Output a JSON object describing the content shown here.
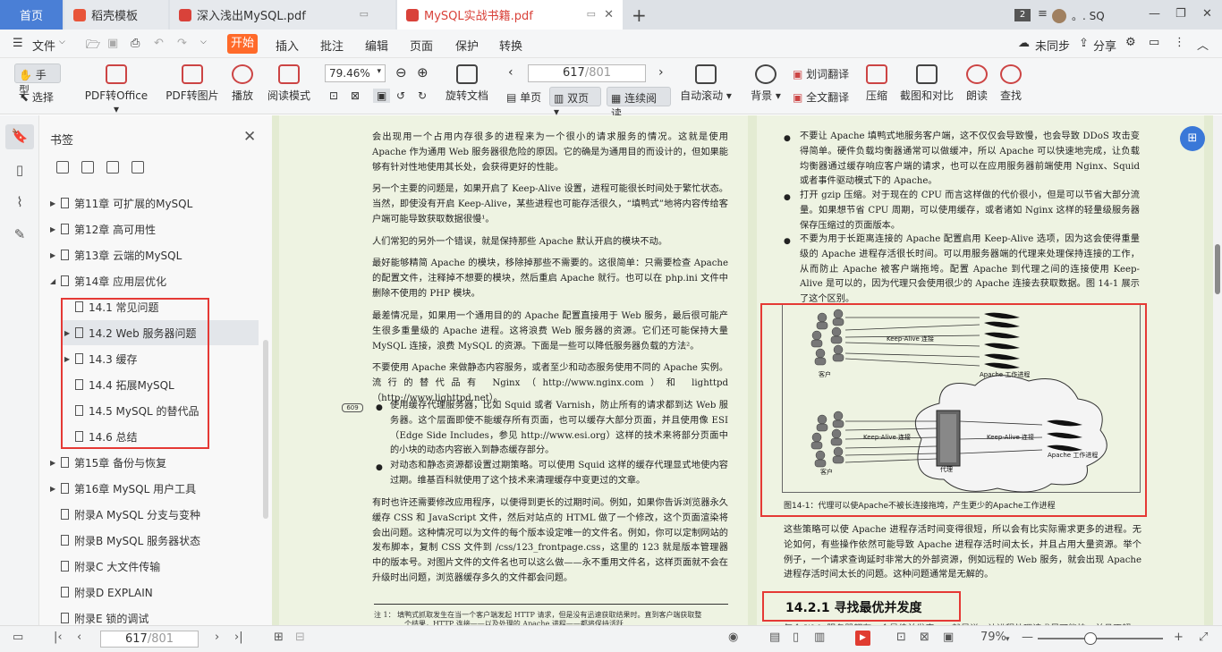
{
  "tabs": {
    "home": "首页",
    "daoke": "稻壳模板",
    "pdf1": "深入浅出MySQL.pdf",
    "pdf2": "MySQL实战书籍.pdf",
    "window_count": "2",
    "user": "。. SQ"
  },
  "menu": {
    "file": "文件",
    "start": "开始",
    "insert": "插入",
    "annotate": "批注",
    "edit": "编辑",
    "page": "页面",
    "protect": "保护",
    "convert": "转换",
    "sync": "未同步",
    "share": "分享"
  },
  "ribbon": {
    "hand": "手型",
    "select": "选择",
    "pdf_to_office": "PDF转Office",
    "pdf_to_image": "PDF转图片",
    "play": "播放",
    "read_mode": "阅读模式",
    "zoom": "79.46%",
    "rotate": "旋转文档",
    "page_current": "617",
    "page_total": "/801",
    "single": "单页",
    "double": "双页",
    "continuous": "连续阅读",
    "auto_scroll": "自动滚动",
    "background": "背景",
    "word_translate": "划词翻译",
    "full_translate": "全文翻译",
    "compress": "压缩",
    "screenshot": "截图和对比",
    "read_aloud": "朗读",
    "find": "查找"
  },
  "bookmarks": {
    "title": "书签",
    "items": [
      {
        "label": "第11章 可扩展的MySQL",
        "expandable": true,
        "level": 0
      },
      {
        "label": "第12章 高可用性",
        "expandable": true,
        "level": 0
      },
      {
        "label": "第13章 云端的MySQL",
        "expandable": true,
        "level": 0
      },
      {
        "label": "第14章 应用层优化",
        "expandable": true,
        "level": 0,
        "expanded": true
      },
      {
        "label": "14.1 常见问题",
        "expandable": false,
        "level": 1
      },
      {
        "label": "14.2 Web 服务器问题",
        "expandable": true,
        "level": 1,
        "selected": true
      },
      {
        "label": "14.3 缓存",
        "expandable": true,
        "level": 1
      },
      {
        "label": "14.4 拓展MySQL",
        "expandable": false,
        "level": 1
      },
      {
        "label": "14.5 MySQL 的替代品",
        "expandable": false,
        "level": 1
      },
      {
        "label": "14.6 总结",
        "expandable": false,
        "level": 1
      },
      {
        "label": "第15章 备份与恢复",
        "expandable": true,
        "level": 0
      },
      {
        "label": "第16章 MySQL 用户工具",
        "expandable": true,
        "level": 0
      },
      {
        "label": "附录A MySQL 分支与变种",
        "expandable": false,
        "level": 0
      },
      {
        "label": "附录B MySQL 服务器状态",
        "expandable": false,
        "level": 0
      },
      {
        "label": "附录C 大文件传输",
        "expandable": false,
        "level": 0
      },
      {
        "label": "附录D EXPLAIN",
        "expandable": false,
        "level": 0
      },
      {
        "label": "附录E 锁的调试",
        "expandable": false,
        "level": 0
      }
    ]
  },
  "left_page": {
    "paragraphs": [
      "会出现用一个占用内存很多的进程来为一个很小的请求服务的情况。这就是使用 Apache 作为通用 Web 服务器很危险的原因。它的确是为通用目的而设计的，但如果能够有针对性地使用其长处，会获得更好的性能。",
      "另一个主要的问题是，如果开启了 Keep-Alive 设置，进程可能很长时间处于繁忙状态。当然，即使没有开启 Keep-Alive，某些进程也可能存活很久，“填鸭式”地将内容传给客户端可能导致获取数据很慢¹。",
      "人们常犯的另外一个错误，就是保持那些 Apache 默认开启的模块不动。",
      "最好能够精简 Apache 的模块，移除掉那些不需要的。这很简单：只需要检查 Apache 的配置文件，注释掉不想要的模块，然后重启 Apache 就行。也可以在 php.ini 文件中删除不使用的 PHP 模块。",
      "最差情况是，如果用一个通用目的的 Apache 配置直接用于 Web 服务，最后很可能产生很多重量级的 Apache 进程。这将浪费 Web 服务器的资源。它们还可能保持大量 MySQL 连接，浪费 MySQL 的资源。下面是一些可以降低服务器负载的方法²。",
      "不要使用 Apache 来做静态内容服务，或者至少和动态服务使用不同的 Apache 实例。流行的替代品有 Nginx（http://www.nginx.com）和 lighttpd（http://www.lighttpd.net）。"
    ],
    "bullets": [
      "使用缓存代理服务器，比如 Squid 或者 Varnish，防止所有的请求都到达 Web 服务器。这个层面即使不能缓存所有页面，也可以缓存大部分页面，并且使用像 ESI（Edge Side Includes，参见 http://www.esi.org）这样的技术来将部分页面中的小块的动态内容嵌入到静态缓存部分。",
      "对动态和静态资源都设置过期策略。可以使用 Squid 这样的缓存代理显式地使内容过期。维基百科就使用了这个技术来清理缓存中变更过的文章。"
    ],
    "para_after": "有时也许还需要修改应用程序，以便得到更长的过期时间。例如，如果你告诉浏览器永久缓存 CSS 和 JavaScript 文件，然后对站点的 HTML 做了一个修改，这个页面渲染将会出问题。这种情况可以为文件的每个版本设定唯一的文件名。例如，你可以定制网站的发布脚本，复制 CSS 文件到 /css/123_frontpage.css，这里的 123 就是版本管理器中的版本号。对图片文件的文件名也可以这么做——永不重用文件名，这样页面就不会在升级时出问题，浏览器缓存多久的文件都会问题。",
    "margin_page": "609",
    "footnote1": "注 1：   填鸭式抓取发生在当一个客户端发起 HTTP 请求，但是没有迅速获取结果时。直到客户端获取整",
    "footnote2": "个结果，HTTP 连接——以及处理的 Apache 进程——都将保持活跃"
  },
  "right_page": {
    "bullets": [
      "不要让 Apache 填鸭式地服务客户端，这不仅仅会导致慢，也会导致 DDoS 攻击变得简单。硬件负载均衡器通常可以做缓冲，所以 Apache 可以快速地完成，让负载均衡器通过缓存响应客户端的请求，也可以在应用服务器前端使用 Nginx、Squid 或者事件驱动模式下的 Apache。",
      "打开 gzip 压缩。对于现在的 CPU 而言这样做的代价很小，但是可以节省大部分流量。如果想节省 CPU 周期，可以使用缓存，或者诸如 Nginx 这样的轻量级服务器保存压缩过的页面版本。",
      "不要为用于长距离连接的 Apache 配置启用 Keep-Alive 选项，因为这会使得重量级的 Apache 进程存活很长时间。可以用服务器端的代理来处理保持连接的工作，从而防止 Apache 被客户端拖垮。配置 Apache 到代理之间的连接使用 Keep-Alive 是可以的，因为代理只会使用很少的 Apache 连接去获取数据。图 14-1 展示了这个区别。"
    ],
    "figure": {
      "keepalive_top": "Keep-Alive 连接",
      "client_top": "客户",
      "worker_top": "Apache 工作进程",
      "keepalive_left": "Keep-Alive 连接",
      "keepalive_right": "Keep-Alive 连接",
      "client_bottom": "客户",
      "proxy": "代理",
      "worker_bottom": "Apache 工作进程",
      "caption": "图14-1：代理可以使Apache不被长连接拖垮，产生更少的Apache工作进程"
    },
    "para_after": "这些策略可以使 Apache 进程存活时间变得很短，所以会有比实际需求更多的进程。无论如何，有些操作依然可能导致 Apache 进程存活时间太长，并且占用大量资源。举个例子，一个请求查询延时非常大的外部资源，例如远程的 Web 服务，就会出现 Apache 进程存活时间太长的问题。这种问题通常是无解的。",
    "section": "14.2.1  寻找最优并发度",
    "cut_text": "每个 Web 服务器都有一个最佳并发度——就是说，让进程处理请求尽可能快，并且不超"
  },
  "status": {
    "page_current": "617",
    "page_total": "/801",
    "zoom": "79%"
  },
  "colors": {
    "accent": "#ff6a2a",
    "tab_home": "#4a7fd6",
    "highlight_box": "#e53935",
    "page_bg": "#eef3e2"
  }
}
